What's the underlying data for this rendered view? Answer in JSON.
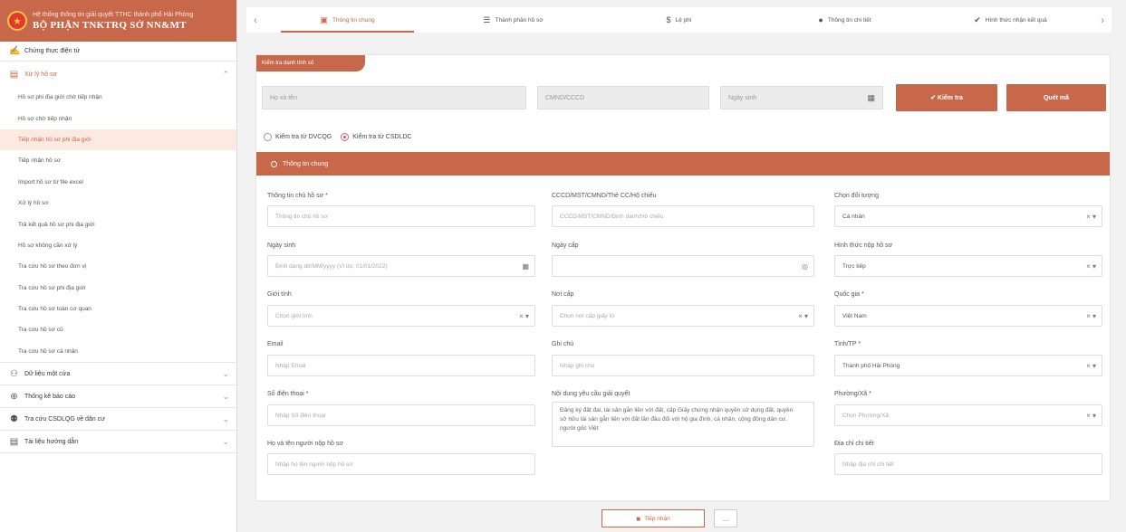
{
  "brand": {
    "subtitle": "Hệ thống thông tin giải quyết TTHC thành phố Hải Phòng",
    "title": "BỘ PHẬN TNKTRQ SỞ NN&MT"
  },
  "sidebar": {
    "top_item": "Chứng thực điện tử",
    "group_xuly": "Xử lý hồ sơ",
    "items": [
      "Hồ sơ phi địa giới chờ tiếp nhận",
      "Hồ sơ chờ tiếp nhận",
      "Tiếp nhận hồ sơ phi địa giới",
      "Tiếp nhận hồ sơ",
      "Import hồ sơ từ file excel",
      "Xử lý hồ sơ",
      "Trả kết quả hồ sơ phi địa giới",
      "Hồ sơ không cần xử lý",
      "Tra cứu hồ sơ theo đơn vị",
      "Tra cứu hồ sơ phi địa giới",
      "Tra cứu hồ sơ toàn cơ quan",
      "Tra cứu hồ sơ cũ",
      "Tra cứu hồ sơ cá nhân"
    ],
    "groups": [
      "Dữ liệu một cửa",
      "Thống kê báo cáo",
      "Tra cứu CSDLQG về dân cư",
      "Tài liệu hướng dẫn"
    ]
  },
  "steps": [
    "Thông tin chung",
    "Thành phần hồ sơ",
    "Lệ phí",
    "Thông tin chi tiết",
    "Hình thức nhận kết quả"
  ],
  "check": {
    "tab_label": "Kiểm tra danh tính số",
    "name_placeholder": "Họ và tên",
    "id_placeholder": "CMND/CCCD",
    "dob_placeholder": "Ngày sinh",
    "check_button": "Kiểm tra",
    "scan_button": "Quét mã",
    "radio_dvcqg": "Kiểm tra từ DVCQG",
    "radio_csdldc": "Kiểm tra từ CSDLDC"
  },
  "section_title": "Thông tin chung",
  "form": {
    "owner_label": "Thông tin chủ hồ sơ *",
    "owner_ph": "Thông tin chủ hồ sơ",
    "idnum_label": "CCCD/MST/CMND/Thẻ CC/Hộ chiếu",
    "idnum_ph": "CCCD/MST/CMND/Định danh/Hộ chiếu",
    "subject_label": "Chọn đối tượng",
    "subject_val": "Cá nhân",
    "dob_label": "Ngày sinh",
    "dob_ph": "Định dạng dd/MM/yyyy (Ví dụ: 01/01/2022)",
    "issue_date_label": "Ngày cấp",
    "submit_method_label": "Hình thức nộp hồ sơ",
    "submit_method_val": "Trực tiếp",
    "gender_label": "Giới tính",
    "gender_ph": "Chọn giới tính",
    "issue_place_label": "Nơi cấp",
    "issue_place_ph": "Chọn nơi cấp giấy tờ",
    "country_label": "Quốc gia *",
    "country_val": "Việt Nam",
    "email_label": "Email",
    "email_ph": "Nhập Email",
    "note_label": "Ghi chú",
    "note_ph": "Nhập ghi chú",
    "province_label": "Tỉnh/TP *",
    "province_val": "Thành phố Hải Phòng",
    "phone_label": "Số điện thoại *",
    "phone_ph": "Nhập Số điện thoại",
    "request_label": "Nội dung yêu cầu giải quyết",
    "request_val": "Đăng ký đất đai, tài sản gắn liền với đất, cấp Giấy chứng nhận quyền sử dụng đất, quyền sở hữu tài sản gắn liền với đất lần đầu đối với hộ gia đình, cá nhân, cộng đồng dân cư, người gốc Việt",
    "ward_label": "Phường/Xã *",
    "ward_ph": "Chọn Phường/Xã",
    "submitter_label": "Họ và tên người nộp hồ sơ",
    "submitter_ph": "Nhập họ tên người nộp hồ sơ",
    "address_label": "Địa chỉ chi tiết",
    "address_ph": "Nhập địa chỉ chi tiết"
  },
  "footer": {
    "next_label": "Tiếp nhận",
    "more_label": "..."
  },
  "colors": {
    "accent": "#c8684b"
  }
}
